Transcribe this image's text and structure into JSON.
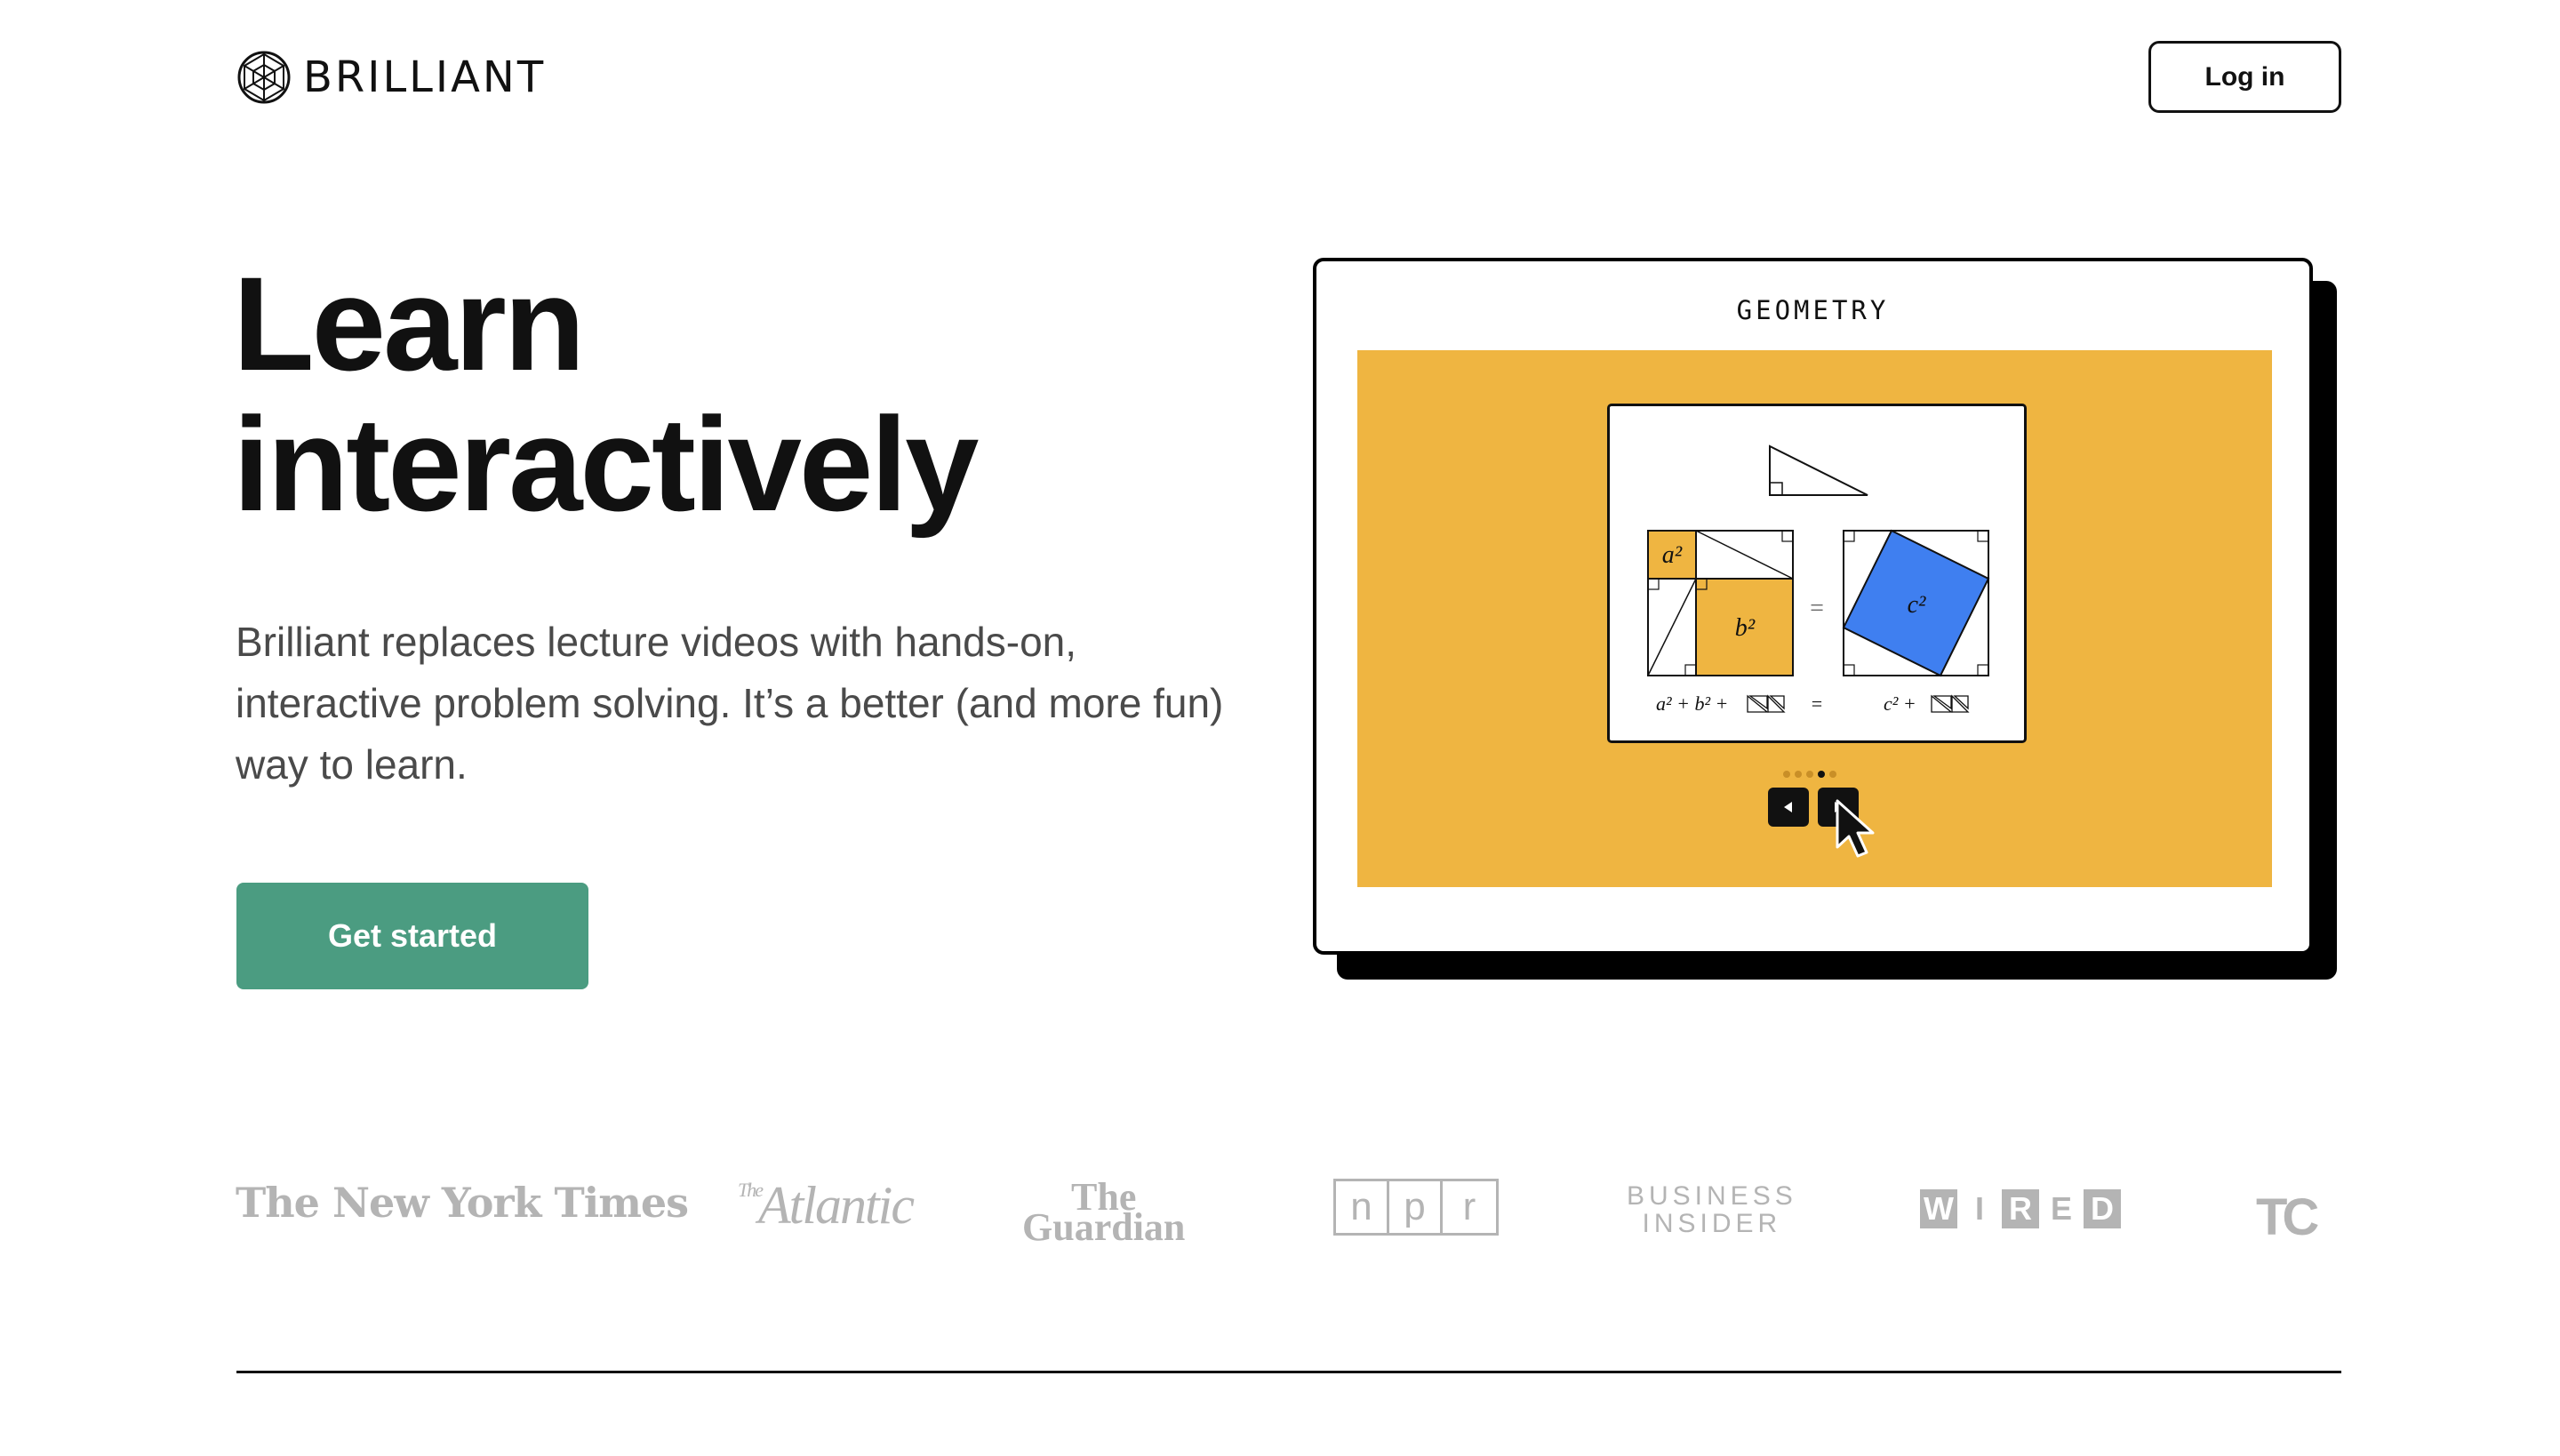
{
  "header": {
    "logo_text": "BRILLIANT",
    "login_label": "Log in"
  },
  "hero": {
    "headline_line1": "Learn",
    "headline_line2": "interactively",
    "subtext": "Brilliant replaces lecture videos with hands-on, interactive problem solving. It’s a better (and more fun) way to learn.",
    "cta_label": "Get started"
  },
  "card": {
    "title": "GEOMETRY",
    "background_color": "#efb541",
    "equation_left": "a² + b² +",
    "equation_equals": "=",
    "equation_right": "c² +",
    "label_a": "a²",
    "label_b": "b²",
    "label_c": "c²",
    "carousel_dots": 5,
    "carousel_active_index": 3
  },
  "press": {
    "logos": [
      "The New York Times",
      "The Atlantic",
      "The Guardian",
      "npr",
      "BUSINESS INSIDER",
      "WIRED",
      "TC"
    ]
  },
  "colors": {
    "accent": "#4b9c81",
    "yellow": "#efb541",
    "blue_square": "#3f7ff0",
    "press_gray": "#b4b4b4"
  }
}
